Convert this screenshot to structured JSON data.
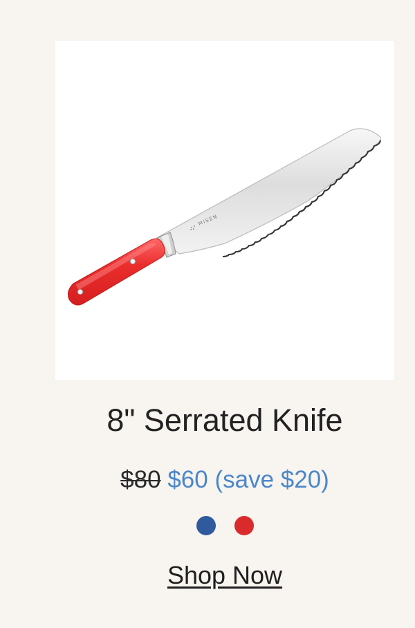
{
  "product": {
    "image": {
      "brand_mark": "MISEN",
      "icon": "bread-knife-photo"
    },
    "title": "8\" Serrated Knife",
    "price": {
      "original": "$80",
      "current": "$60",
      "savings": "(save $20)"
    },
    "swatches": [
      {
        "color": "#2f5b9e",
        "icon": "navy-swatch"
      },
      {
        "color": "#d92b2b",
        "icon": "red-swatch"
      }
    ],
    "cta": {
      "label": "Shop Now"
    }
  }
}
